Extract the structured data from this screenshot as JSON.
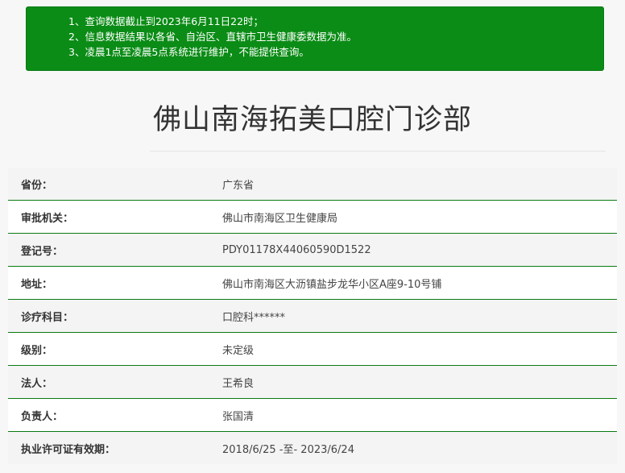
{
  "notice": {
    "lines": [
      "1、查询数据截止到2023年6月11日22时；",
      "2、信息数据结果以各省、自治区、直辖市卫生健康委数据为准。",
      "3、凌晨1点至凌晨5点系统进行维护，不能提供查询。"
    ]
  },
  "title": "佛山南海拓美口腔门诊部",
  "rows": [
    {
      "label": "省份：",
      "value": "广东省"
    },
    {
      "label": "审批机关：",
      "value": "佛山市南海区卫生健康局"
    },
    {
      "label": "登记号：",
      "value": "PDY01178X44060590D1522"
    },
    {
      "label": "地址：",
      "value": "佛山市南海区大沥镇盐步龙华小区A座9-10号铺"
    },
    {
      "label": "诊疗科目：",
      "value": "口腔科******"
    },
    {
      "label": "级别：",
      "value": "未定级"
    },
    {
      "label": "法人：",
      "value": "王希良"
    },
    {
      "label": "负责人：",
      "value": "张国清"
    },
    {
      "label": "执业许可证有效期：",
      "value": "2018/6/25 -至- 2023/6/24"
    }
  ]
}
